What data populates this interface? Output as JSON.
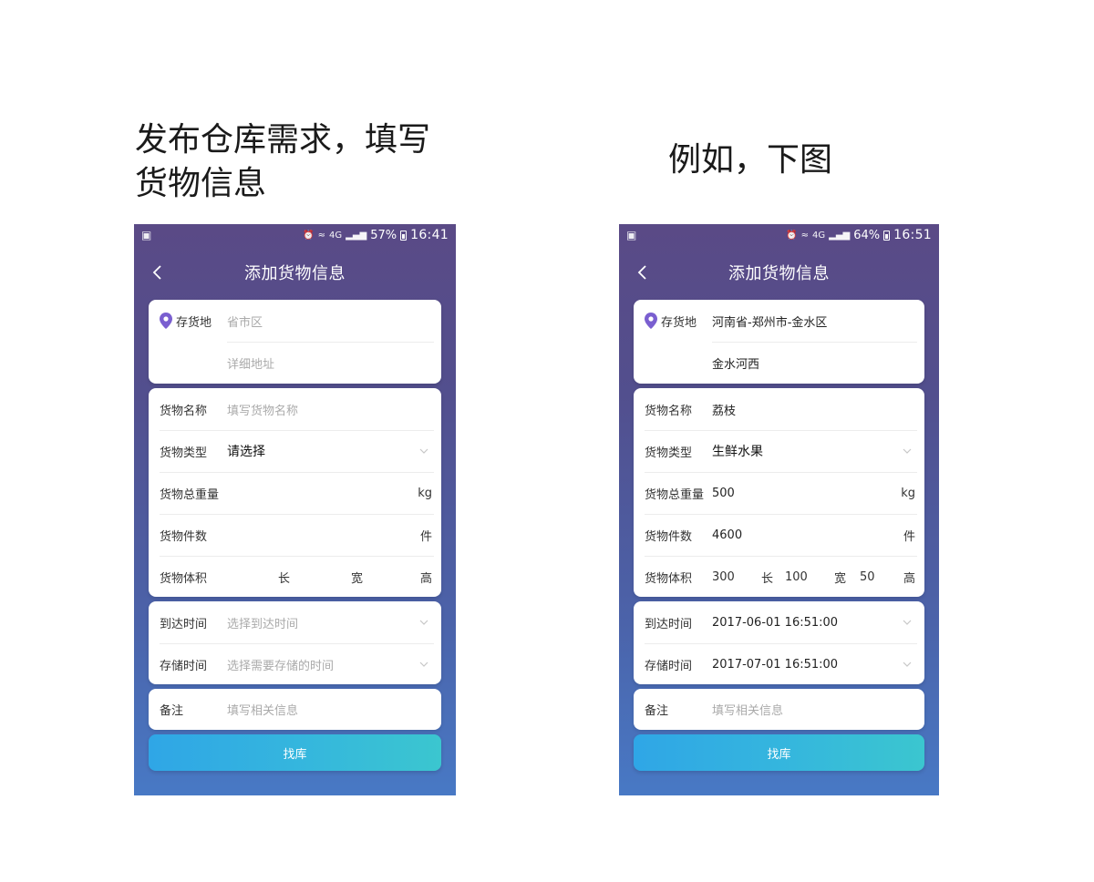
{
  "captions": {
    "left": "发布仓库需求，填写货物信息",
    "right": "例如，下图"
  },
  "screens": [
    {
      "status": {
        "battery_percent": "57%",
        "time": "16:41",
        "network": "4G"
      },
      "nav_title": "添加货物信息",
      "location": {
        "label": "存货地",
        "region": "省市区",
        "detail": "详细地址"
      },
      "cargo": {
        "name_label": "货物名称",
        "name": "填写货物名称",
        "type_label": "货物类型",
        "type": "请选择",
        "weight_label": "货物总重量",
        "weight": "",
        "weight_unit": "kg",
        "count_label": "货物件数",
        "count": "",
        "count_unit": "件",
        "volume_label": "货物体积",
        "length": "",
        "length_unit": "长",
        "width": "",
        "width_unit": "宽",
        "height_unit": "高"
      },
      "time": {
        "arrive_label": "到达时间",
        "arrive": "选择到达时间",
        "store_label": "存储时间",
        "store": "选择需要存储的时间"
      },
      "remark": {
        "label": "备注",
        "placeholder": "填写相关信息"
      },
      "submit_label": "找库"
    },
    {
      "status": {
        "battery_percent": "64%",
        "time": "16:51",
        "network": "4G"
      },
      "nav_title": "添加货物信息",
      "location": {
        "label": "存货地",
        "region": "河南省-郑州市-金水区",
        "detail": "金水河西"
      },
      "cargo": {
        "name_label": "货物名称",
        "name": "荔枝",
        "type_label": "货物类型",
        "type": "生鲜水果",
        "weight_label": "货物总重量",
        "weight": "500",
        "weight_unit": "kg",
        "count_label": "货物件数",
        "count": "4600",
        "count_unit": "件",
        "volume_label": "货物体积",
        "length": "300",
        "length_unit": "长",
        "width": "100",
        "width_unit": "宽",
        "height": "50",
        "height_unit": "高"
      },
      "time": {
        "arrive_label": "到达时间",
        "arrive": "2017-06-01 16:51:00",
        "store_label": "存储时间",
        "store": "2017-07-01 16:51:00"
      },
      "remark": {
        "label": "备注",
        "placeholder": "填写相关信息"
      },
      "submit_label": "找库"
    }
  ],
  "colors": {
    "accent_pin": "#7a5fd0",
    "button_start": "#2fa6e6",
    "button_end": "#3bc6cf"
  }
}
